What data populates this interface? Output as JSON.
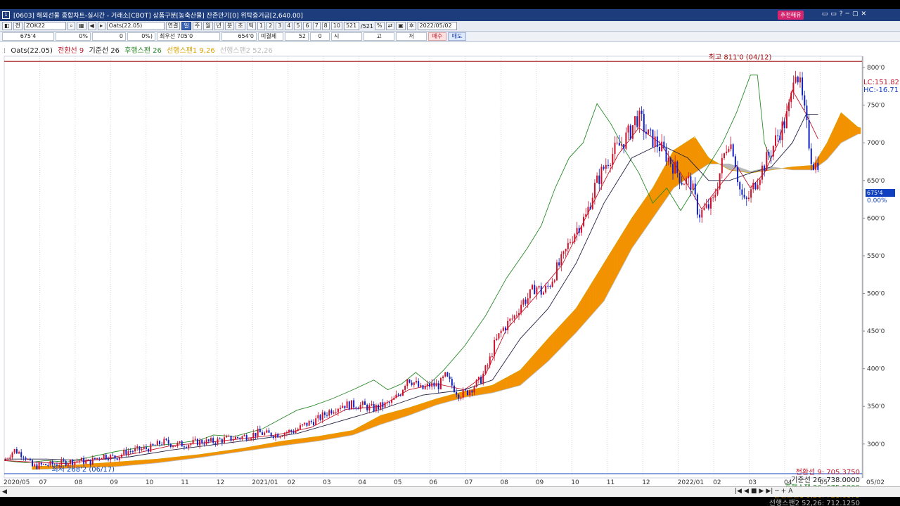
{
  "window": {
    "app_icon": "1",
    "title": "[0603] 해외선물 종합차트-실시간 - 거래소[CBOT] 상품구분[농축산물] 잔존만기[0] 위탁증거금[2,640.00]",
    "recommend_label": "추천해유",
    "controls": [
      "▭",
      "▭",
      "?",
      "─",
      "▢",
      "✕"
    ]
  },
  "toolbar1": {
    "type_label": "전",
    "code": "ZOK22",
    "symbol": "Oats(22.05)",
    "link_label": "연결",
    "periods": [
      "일",
      "주",
      "월",
      "년",
      "분",
      "초",
      "틱"
    ],
    "active_period": "일",
    "numbers": [
      "1",
      "2",
      "3",
      "4",
      "5",
      "6",
      "7",
      "8",
      "10"
    ],
    "count": "521",
    "count_total": "/521",
    "date": "2022/05/02"
  },
  "toolbar2": {
    "price": "675'4",
    "change": "0%",
    "vol": "0",
    "pct": "0%)",
    "best_ask": "최우선 705'0",
    "bid": "654'0",
    "open_interest": "미결제",
    "oi_value": "52",
    "oi_chg": "0",
    "open_label": "시",
    "high_label": "고",
    "low_label": "저",
    "buy_label": "매수",
    "sell_label": "매도"
  },
  "legend": {
    "symbol": "Oats(22.05)",
    "items": [
      {
        "label": "전환선 9",
        "color": "#c0182a"
      },
      {
        "label": "기준선 26",
        "color": "#222222"
      },
      {
        "label": "후행스팬 26",
        "color": "#2a8a2a"
      },
      {
        "label": "선행스팬1 9,26",
        "color": "#d8a000"
      },
      {
        "label": "선행스팬2 52,26",
        "color": "#bbbbbb"
      }
    ]
  },
  "annotations": {
    "high": "최고 811'0 (04/12)",
    "low": "최저 268'2 (06/17)",
    "lc": "LC:151.82",
    "hc": "HC:-16.71",
    "price_tag": "675'4",
    "pct_tag": "0.00%"
  },
  "values": [
    {
      "label": "전환선 9: 705.3750",
      "color": "#c0182a"
    },
    {
      "label": "기준선 26: 738.0000",
      "color": "#222222"
    },
    {
      "label": "후행스팬 26: 675.5000",
      "color": "#2a8a2a"
    },
    {
      "label": "선행스팬1 9,26: 721.6875",
      "color": "#d8a000"
    },
    {
      "label": "선행스팬2 52,26: 712.1250",
      "color": "#bbbbbb"
    }
  ],
  "bottom": {
    "left_arrow": "◀",
    "right_arrow": "▶",
    "nav_buttons": [
      "|◀",
      "◀",
      "■",
      "▶",
      "▶|",
      "─",
      "+",
      "A"
    ]
  },
  "chart_data": {
    "type": "candlestick",
    "y_ticks": [
      "800'0",
      "750'0",
      "700'0",
      "650'0",
      "600'0",
      "550'0",
      "500'0",
      "450'0",
      "400'0",
      "350'0",
      "300'0"
    ],
    "y_tick_values": [
      800,
      750,
      700,
      650,
      600,
      550,
      500,
      450,
      400,
      350,
      300
    ],
    "ylim": [
      255,
      815
    ],
    "x_labels": [
      "2020/05",
      "07",
      "08",
      "09",
      "10",
      "11",
      "12",
      "2021/01",
      "02",
      "03",
      "04",
      "05",
      "06",
      "07",
      "08",
      "09",
      "10",
      "11",
      "12",
      "2022/01",
      "02",
      "03",
      "04",
      "05"
    ],
    "x_label_right": "05/02",
    "grid": "vertical",
    "colors": {
      "up": "#d0102a",
      "down": "#1020c0",
      "cloud_up": "#f39200",
      "cloud_down": "#b8b8b8"
    },
    "close_series": {
      "name": "Oats(22.05)",
      "points": [
        [
          0,
          278
        ],
        [
          14,
          292
        ],
        [
          29,
          285
        ],
        [
          40,
          270
        ],
        [
          55,
          272
        ],
        [
          72,
          273
        ],
        [
          90,
          276
        ],
        [
          108,
          278
        ],
        [
          122,
          276
        ],
        [
          140,
          285
        ],
        [
          160,
          282
        ],
        [
          175,
          290
        ],
        [
          192,
          292
        ],
        [
          210,
          295
        ],
        [
          228,
          303
        ],
        [
          245,
          299
        ],
        [
          262,
          300
        ],
        [
          280,
          303
        ],
        [
          296,
          303
        ],
        [
          315,
          306
        ],
        [
          332,
          308
        ],
        [
          350,
          311
        ],
        [
          365,
          315
        ],
        [
          378,
          313
        ],
        [
          392,
          313
        ],
        [
          405,
          316
        ],
        [
          418,
          318
        ],
        [
          432,
          326
        ],
        [
          450,
          333
        ],
        [
          468,
          345
        ],
        [
          484,
          352
        ],
        [
          500,
          352
        ],
        [
          514,
          351
        ],
        [
          528,
          347
        ],
        [
          540,
          350
        ],
        [
          555,
          355
        ],
        [
          568,
          368
        ],
        [
          578,
          388
        ],
        [
          590,
          380
        ],
        [
          598,
          372
        ],
        [
          610,
          378
        ],
        [
          624,
          378
        ],
        [
          632,
          390
        ],
        [
          642,
          378
        ],
        [
          652,
          366
        ],
        [
          662,
          368
        ],
        [
          672,
          376
        ],
        [
          683,
          385
        ],
        [
          695,
          408
        ],
        [
          702,
          430
        ],
        [
          714,
          452
        ],
        [
          724,
          462
        ],
        [
          732,
          470
        ],
        [
          742,
          488
        ],
        [
          752,
          495
        ],
        [
          762,
          510
        ],
        [
          772,
          500
        ],
        [
          782,
          512
        ],
        [
          792,
          532
        ],
        [
          802,
          548
        ],
        [
          812,
          572
        ],
        [
          822,
          588
        ],
        [
          834,
          602
        ],
        [
          846,
          640
        ],
        [
          856,
          660
        ],
        [
          866,
          678
        ],
        [
          876,
          690
        ],
        [
          888,
          702
        ],
        [
          898,
          716
        ],
        [
          906,
          734
        ],
        [
          914,
          728
        ],
        [
          922,
          710
        ],
        [
          932,
          703
        ],
        [
          944,
          690
        ],
        [
          958,
          672
        ],
        [
          972,
          650
        ],
        [
          984,
          648
        ],
        [
          996,
          605
        ],
        [
          1006,
          612
        ],
        [
          1016,
          620
        ],
        [
          1026,
          660
        ],
        [
          1038,
          705
        ],
        [
          1046,
          690
        ],
        [
          1054,
          640
        ],
        [
          1062,
          618
        ],
        [
          1070,
          632
        ],
        [
          1078,
          650
        ],
        [
          1088,
          668
        ],
        [
          1100,
          690
        ],
        [
          1110,
          712
        ],
        [
          1120,
          728
        ],
        [
          1128,
          756
        ],
        [
          1133,
          808
        ],
        [
          1140,
          780
        ],
        [
          1146,
          748
        ],
        [
          1152,
          712
        ],
        [
          1158,
          676
        ],
        [
          1163,
          670
        ],
        [
          1167,
          675.5
        ]
      ]
    },
    "tenkan": {
      "name": "전환선 9",
      "points": [
        [
          0,
          278
        ],
        [
          40,
          276
        ],
        [
          90,
          274
        ],
        [
          140,
          280
        ],
        [
          190,
          288
        ],
        [
          240,
          298
        ],
        [
          290,
          302
        ],
        [
          340,
          307
        ],
        [
          390,
          312
        ],
        [
          440,
          322
        ],
        [
          490,
          346
        ],
        [
          540,
          350
        ],
        [
          580,
          372
        ],
        [
          620,
          380
        ],
        [
          660,
          372
        ],
        [
          690,
          392
        ],
        [
          720,
          452
        ],
        [
          760,
          494
        ],
        [
          800,
          538
        ],
        [
          840,
          612
        ],
        [
          880,
          684
        ],
        [
          910,
          720
        ],
        [
          940,
          700
        ],
        [
          970,
          660
        ],
        [
          1000,
          612
        ],
        [
          1030,
          648
        ],
        [
          1050,
          670
        ],
        [
          1070,
          640
        ],
        [
          1090,
          660
        ],
        [
          1110,
          700
        ],
        [
          1130,
          770
        ],
        [
          1150,
          738
        ],
        [
          1167,
          705
        ]
      ]
    },
    "kijun": {
      "name": "기준선 26",
      "points": [
        [
          0,
          280
        ],
        [
          60,
          280
        ],
        [
          120,
          278
        ],
        [
          180,
          283
        ],
        [
          240,
          292
        ],
        [
          300,
          299
        ],
        [
          360,
          306
        ],
        [
          420,
          314
        ],
        [
          480,
          330
        ],
        [
          540,
          346
        ],
        [
          600,
          365
        ],
        [
          660,
          372
        ],
        [
          700,
          385
        ],
        [
          740,
          440
        ],
        [
          780,
          480
        ],
        [
          820,
          540
        ],
        [
          860,
          620
        ],
        [
          900,
          680
        ],
        [
          940,
          698
        ],
        [
          980,
          680
        ],
        [
          1010,
          650
        ],
        [
          1040,
          650
        ],
        [
          1070,
          660
        ],
        [
          1100,
          668
        ],
        [
          1130,
          700
        ],
        [
          1150,
          738
        ],
        [
          1167,
          738
        ]
      ]
    },
    "chikou": {
      "name": "후행스팬 26",
      "points": [
        [
          0,
          278
        ],
        [
          30,
          275
        ],
        [
          60,
          278
        ],
        [
          90,
          276
        ],
        [
          120,
          282
        ],
        [
          160,
          290
        ],
        [
          200,
          296
        ],
        [
          240,
          300
        ],
        [
          280,
          305
        ],
        [
          300,
          312
        ],
        [
          330,
          310
        ],
        [
          370,
          320
        ],
        [
          400,
          335
        ],
        [
          420,
          345
        ],
        [
          440,
          350
        ],
        [
          470,
          360
        ],
        [
          500,
          372
        ],
        [
          530,
          385
        ],
        [
          550,
          372
        ],
        [
          570,
          380
        ],
        [
          590,
          395
        ],
        [
          610,
          380
        ],
        [
          630,
          398
        ],
        [
          660,
          430
        ],
        [
          690,
          470
        ],
        [
          720,
          520
        ],
        [
          750,
          560
        ],
        [
          770,
          590
        ],
        [
          790,
          640
        ],
        [
          810,
          680
        ],
        [
          830,
          700
        ],
        [
          850,
          752
        ],
        [
          870,
          725
        ],
        [
          890,
          690
        ],
        [
          910,
          660
        ],
        [
          930,
          620
        ],
        [
          950,
          640
        ],
        [
          970,
          610
        ],
        [
          990,
          640
        ],
        [
          1010,
          670
        ],
        [
          1030,
          700
        ],
        [
          1050,
          740
        ],
        [
          1070,
          790
        ],
        [
          1080,
          790
        ],
        [
          1090,
          700
        ],
        [
          1100,
          675.5
        ]
      ]
    },
    "senkou_a": {
      "name": "선행스팬1 9,26",
      "points": [
        [
          40,
          270
        ],
        [
          100,
          272
        ],
        [
          160,
          276
        ],
        [
          220,
          280
        ],
        [
          280,
          286
        ],
        [
          340,
          294
        ],
        [
          400,
          304
        ],
        [
          450,
          310
        ],
        [
          500,
          318
        ],
        [
          540,
          338
        ],
        [
          580,
          348
        ],
        [
          620,
          360
        ],
        [
          660,
          370
        ],
        [
          700,
          378
        ],
        [
          740,
          398
        ],
        [
          780,
          440
        ],
        [
          820,
          480
        ],
        [
          860,
          540
        ],
        [
          900,
          600
        ],
        [
          930,
          640
        ],
        [
          960,
          690
        ],
        [
          990,
          708
        ],
        [
          1010,
          680
        ],
        [
          1040,
          664
        ],
        [
          1070,
          660
        ],
        [
          1100,
          664
        ],
        [
          1130,
          668
        ],
        [
          1160,
          670
        ],
        [
          1180,
          700
        ],
        [
          1200,
          740
        ],
        [
          1225,
          720
        ]
      ]
    },
    "senkou_b": {
      "name": "선행스팬2 52,26",
      "points": [
        [
          40,
          266
        ],
        [
          100,
          268
        ],
        [
          160,
          270
        ],
        [
          220,
          275
        ],
        [
          280,
          282
        ],
        [
          340,
          290
        ],
        [
          400,
          298
        ],
        [
          450,
          304
        ],
        [
          500,
          312
        ],
        [
          540,
          326
        ],
        [
          580,
          338
        ],
        [
          620,
          352
        ],
        [
          660,
          362
        ],
        [
          700,
          368
        ],
        [
          740,
          378
        ],
        [
          780,
          410
        ],
        [
          820,
          448
        ],
        [
          860,
          490
        ],
        [
          900,
          560
        ],
        [
          930,
          600
        ],
        [
          960,
          640
        ],
        [
          990,
          660
        ],
        [
          1010,
          672
        ],
        [
          1040,
          672
        ],
        [
          1070,
          662
        ],
        [
          1100,
          668
        ],
        [
          1130,
          664
        ],
        [
          1160,
          664
        ],
        [
          1180,
          678
        ],
        [
          1200,
          700
        ],
        [
          1225,
          712
        ]
      ]
    }
  }
}
